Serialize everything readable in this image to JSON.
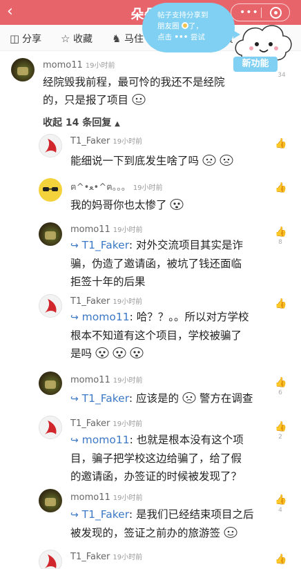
{
  "header": {
    "title": "朵朵校",
    "back_icon": "chevron-left-icon",
    "more_icon": "more-dots-icon",
    "close_icon": "target-icon",
    "bg": "#e8646b"
  },
  "toolbar": {
    "share_label": "分享",
    "collect_label": "收藏",
    "horse_label": "马住",
    "cut_label": "赏"
  },
  "tooltip": {
    "line1": "帖子支持分享到",
    "line2": "朋友圈",
    "line2b": "了，",
    "line3": "点击",
    "line3b": "尝试"
  },
  "badge": {
    "new_feature": "新功能"
  },
  "main_comment": {
    "user": "momo11",
    "time": "19小时前",
    "text_line1": "经院毁我前程，最可怜的我还不是经院",
    "text_line2": "的，只是报了项目",
    "like_count": "34"
  },
  "collapse": {
    "label": "收起 14 条回复",
    "icon": "caret-up-icon"
  },
  "replies": [
    {
      "user": "T1_Faker",
      "time": "19小时前",
      "lines": [
        "能细说一下到底发生啥了吗"
      ],
      "like_count": ""
    },
    {
      "user": "ฅ^•ﻌ•^ฅ。。。",
      "time": "19小时前",
      "lines": [
        "我的妈哥你也太惨了"
      ],
      "like_count": ""
    },
    {
      "user": "momo11",
      "time": "19小时前",
      "reply_to": "T1_Faker",
      "lines": [
        "对外交流项目其实是诈",
        "骗，伪造了邀请函，被坑了钱还面临",
        "拒签十年的后果"
      ],
      "like_count": "8"
    },
    {
      "user": "T1_Faker",
      "time": "19小时前",
      "reply_to": "momo11",
      "lines": [
        "哈？？。。所以对方学校",
        "根本不知道有这个项目，学校被骗了",
        "是吗"
      ],
      "like_count": ""
    },
    {
      "user": "momo11",
      "time": "19小时前",
      "reply_to": "T1_Faker",
      "lines": [
        "应该是的",
        "警方在调查"
      ],
      "like_count": "6"
    },
    {
      "user": "T1_Faker",
      "time": "19小时前",
      "reply_to": "momo11",
      "lines": [
        "也就是根本没有这个项",
        "目，骗子把学校这边给骗了，给了假",
        "的邀请函，办签证的时候被发现了？"
      ],
      "like_count": "2"
    },
    {
      "user": "momo11",
      "time": "19小时前",
      "reply_to": "T1_Faker",
      "lines": [
        "是我们已经结束项目之后",
        "被发现的，签证之前办的旅游签"
      ],
      "like_count": "4"
    },
    {
      "user": "T1_Faker",
      "time": "19小时前",
      "lines": [],
      "like_count": ""
    }
  ]
}
